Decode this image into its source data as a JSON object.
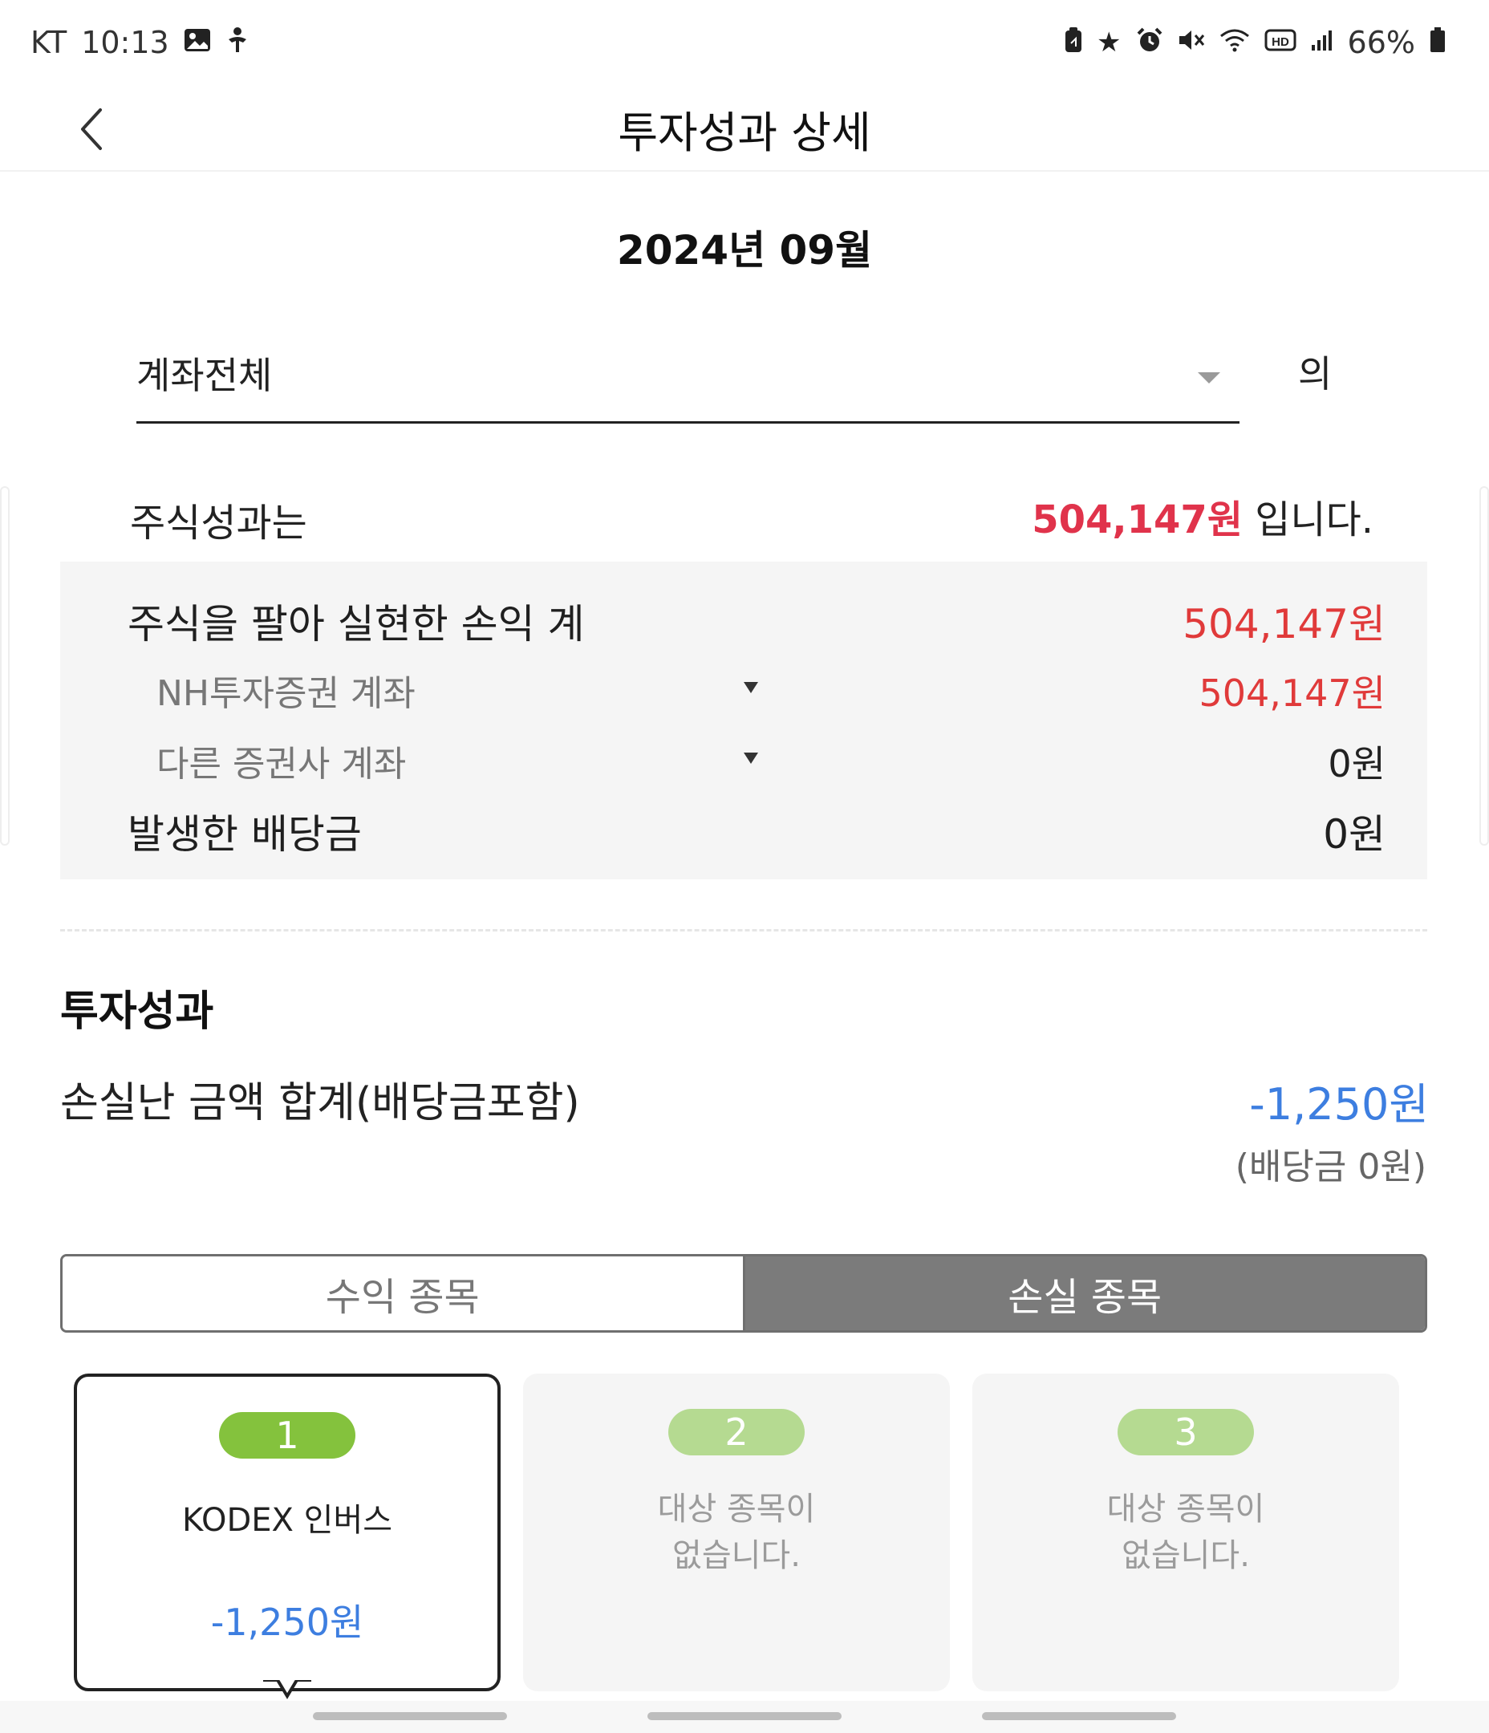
{
  "status_bar": {
    "carrier": "KT",
    "time": "10:13",
    "battery": "66%",
    "left_icons": [
      "image-icon",
      "accessibility-icon"
    ],
    "right_icons": [
      "lock-screen-icon",
      "star-icon",
      "alarm-icon",
      "mute-icon",
      "wifi-icon",
      "hd-icon",
      "signal-icon",
      "battery-icon"
    ]
  },
  "header": {
    "title": "투자성과 상세"
  },
  "period": "2024년 09월",
  "account_selector": {
    "value": "계좌전체",
    "suffix": "의"
  },
  "summary": {
    "label": "주식성과는",
    "amount": "504,147원",
    "suffix": " 입니다."
  },
  "details": {
    "realized": {
      "label": "주식을 팔아 실현한 손익 계",
      "value": "504,147원"
    },
    "accounts": [
      {
        "label": "NH투자증권 계좌",
        "value": "504,147원"
      },
      {
        "label": "다른 증권사 계좌",
        "value": "0원"
      }
    ],
    "dividend": {
      "label": "발생한 배당금",
      "value": "0원"
    }
  },
  "performance": {
    "title": "투자성과",
    "loss_label": "손실난 금액 합계(배당금포함)",
    "loss_value": "-1,250원",
    "dividend_note": "(배당금 0원)"
  },
  "tabs": [
    {
      "label": "수익 종목",
      "active": false
    },
    {
      "label": "손실 종목",
      "active": true
    }
  ],
  "cards": [
    {
      "rank": "1",
      "name": "KODEX 인버스",
      "value": "-1,250원",
      "selected": true
    },
    {
      "rank": "2",
      "empty_line1": "대상 종목이",
      "empty_line2": "없습니다."
    },
    {
      "rank": "3",
      "empty_line1": "대상 종목이",
      "empty_line2": "없습니다."
    }
  ],
  "colors": {
    "profit_red": "#e03a3a",
    "loss_blue": "#3d7ee0",
    "rank_green": "#84c23d",
    "rank_green_light": "#b5da91",
    "active_tab_gray": "#7b7b7b"
  }
}
